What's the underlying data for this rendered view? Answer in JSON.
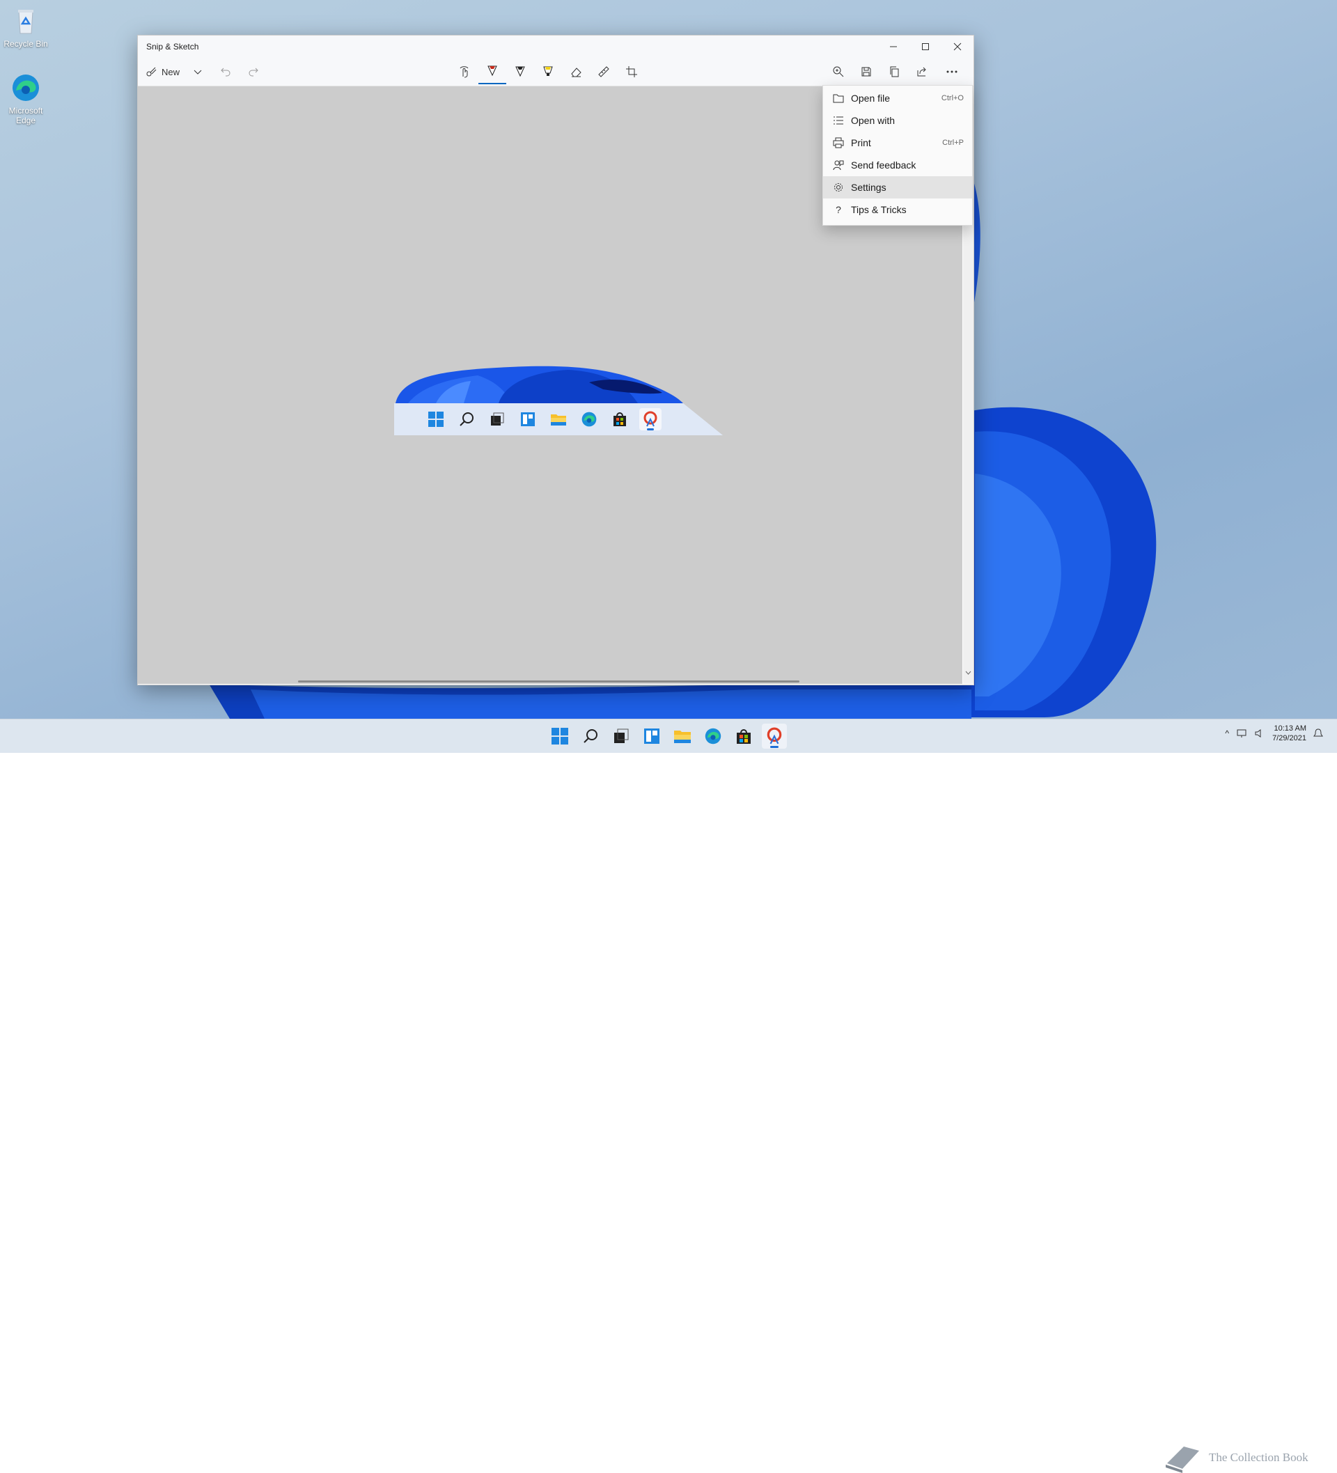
{
  "desktop": {
    "icons": [
      {
        "label": "Recycle Bin",
        "icon": "recycle-bin-icon"
      },
      {
        "label": "Microsoft Edge",
        "icon": "edge-icon"
      }
    ]
  },
  "window": {
    "title": "Snip & Sketch",
    "controls": {
      "minimize": "minimize-icon",
      "maximize": "maximize-icon",
      "close": "close-icon"
    }
  },
  "toolbar": {
    "new_label": "New",
    "left_icons": [
      "new-snip-icon",
      "chevron-down-icon",
      "undo-icon",
      "redo-icon"
    ],
    "center_icons": [
      "touch-writing-icon",
      "ballpoint-pen-icon",
      "pencil-icon",
      "highlighter-icon",
      "eraser-icon",
      "ruler-icon",
      "crop-icon"
    ],
    "right_icons": [
      "zoom-icon",
      "save-icon",
      "copy-icon",
      "share-icon",
      "more-icon"
    ],
    "accent": "#c42b1c"
  },
  "menu": {
    "items": [
      {
        "label": "Open file",
        "shortcut": "Ctrl+O",
        "icon": "folder-icon"
      },
      {
        "label": "Open with",
        "shortcut": "",
        "icon": "list-icon"
      },
      {
        "label": "Print",
        "shortcut": "Ctrl+P",
        "icon": "printer-icon"
      },
      {
        "label": "Send feedback",
        "shortcut": "",
        "icon": "feedback-icon"
      },
      {
        "label": "Settings",
        "shortcut": "",
        "icon": "gear-icon"
      },
      {
        "label": "Tips & Tricks",
        "shortcut": "",
        "icon": "question-icon"
      }
    ],
    "highlighted": "Settings"
  },
  "taskbar": {
    "icons": [
      "start-icon",
      "search-icon",
      "task-view-icon",
      "widgets-icon",
      "file-explorer-icon",
      "edge-icon",
      "store-icon",
      "snip-sketch-icon"
    ],
    "active": "snip-sketch-icon"
  },
  "tray": {
    "time": "10:13 AM",
    "date": "7/29/2021"
  },
  "watermark": {
    "text": "The Collection Book"
  },
  "colors": {
    "window_blue": "#0a4fd6",
    "menu_bg": "#fafafa",
    "canvas_bg": "#cccccc"
  }
}
